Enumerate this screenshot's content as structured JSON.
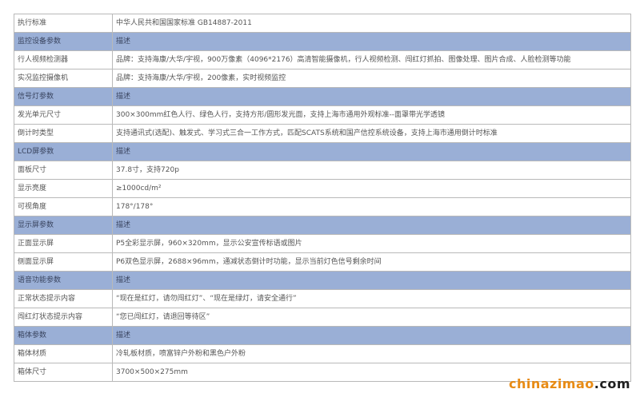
{
  "rows": [
    {
      "type": "row",
      "label": "执行标准",
      "value": "中华人民共和国国家标准 GB14887-2011"
    },
    {
      "type": "section",
      "label": "监控设备参数",
      "value": "描述"
    },
    {
      "type": "row",
      "label": "行人视频检测器",
      "value": "品牌：支持海康/大华/宇视，900万像素（4096*2176）高清智能摄像机，行人视频检测、闯红灯抓拍、图像处理、图片合成、人脸检测等功能"
    },
    {
      "type": "row",
      "label": "实况监控摄像机",
      "value": "品牌：支持海康/大华/宇视，200像素，实时视频监控"
    },
    {
      "type": "section",
      "label": "信号灯参数",
      "value": "描述"
    },
    {
      "type": "row",
      "label": "发光单元尺寸",
      "value": "300×300mm红色人行、绿色人行，支持方形/圆形发光面，支持上海市通用外观标准--面罩带光学透镜"
    },
    {
      "type": "row",
      "label": "倒计时类型",
      "value": "支持通讯式(选配)、触发式、学习式三合一工作方式，匹配SCATS系统和国产信控系统设备，支持上海市通用倒计时标准"
    },
    {
      "type": "section",
      "label": "LCD屏参数",
      "value": "描述"
    },
    {
      "type": "row",
      "label": "面板尺寸",
      "value": "37.8寸，支持720p"
    },
    {
      "type": "row",
      "label": "显示亮度",
      "value": "≥1000cd/m²"
    },
    {
      "type": "row",
      "label": "可视角度",
      "value": "178°/178°"
    },
    {
      "type": "section",
      "label": "显示屏参数",
      "value": "描述"
    },
    {
      "type": "row",
      "label": "正面显示屏",
      "value": "P5全彩显示屏，960×320mm，显示公安宣传标语或图片"
    },
    {
      "type": "row",
      "label": "侧面显示屏",
      "value": "P6双色显示屏，2688×96mm，通减状态倒计时功能，显示当前灯色信号剩余时间"
    },
    {
      "type": "section",
      "label": "语音功能参数",
      "value": "描述"
    },
    {
      "type": "row",
      "label": "正常状态提示内容",
      "value": "“现在是红灯，请勿闯红灯”、“现在是绿灯，请安全通行”"
    },
    {
      "type": "row",
      "label": "闯红灯状态提示内容",
      "value": "“您已闯红灯，请退回等待区”"
    },
    {
      "type": "section",
      "label": "箱体参数",
      "value": "描述"
    },
    {
      "type": "row",
      "label": "箱体材质",
      "value": "冷轧板材质，喷富锌户外粉和黑色户外粉"
    },
    {
      "type": "row",
      "label": "箱体尺寸",
      "value": "3700×500×275mm"
    }
  ],
  "watermark": {
    "part1": "chinazimao",
    "part2": ".com"
  }
}
